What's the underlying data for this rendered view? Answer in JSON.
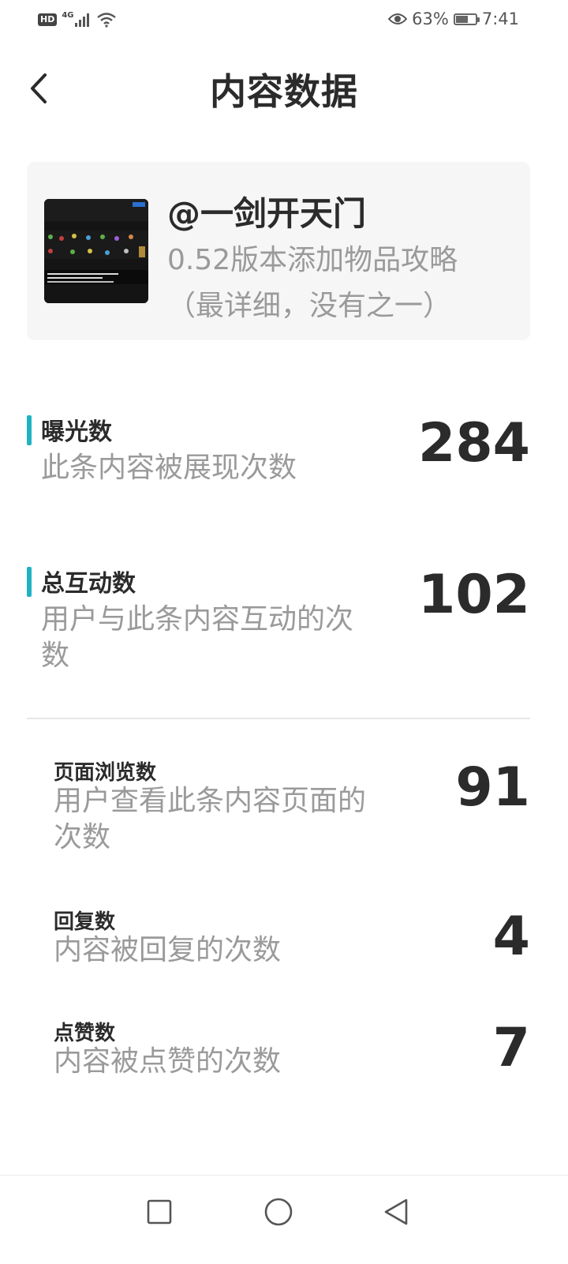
{
  "status_bar": {
    "hd": "HD",
    "network": "4G",
    "battery_percent": "63%",
    "battery_level": 0.63,
    "time": "7:41"
  },
  "header": {
    "title": "内容数据",
    "back_icon": "chevron-left-icon"
  },
  "content_card": {
    "author": "@一剑开天门",
    "title": "0.52版本添加物品攻略（最详细，没有之一）"
  },
  "metrics": [
    {
      "label": "曝光数",
      "description": "此条内容被展现次数",
      "value": "284"
    },
    {
      "label": "总互动数",
      "description": "用户与此条内容互动的次数",
      "value": "102"
    }
  ],
  "sub_metrics": [
    {
      "label": "页面浏览数",
      "description": "用户查看此条内容页面的次数",
      "value": "91"
    },
    {
      "label": "回复数",
      "description": "内容被回复的次数",
      "value": "4"
    },
    {
      "label": "点赞数",
      "description": "内容被点赞的次数",
      "value": "7"
    }
  ],
  "colors": {
    "accent": "#1fb3c2",
    "text_primary": "#2b2b2b",
    "text_secondary": "#9a9a9a",
    "card_bg": "#f6f6f6"
  },
  "nav_bar": {
    "recent_icon": "square-icon",
    "home_icon": "circle-icon",
    "back_icon": "triangle-back-icon"
  }
}
